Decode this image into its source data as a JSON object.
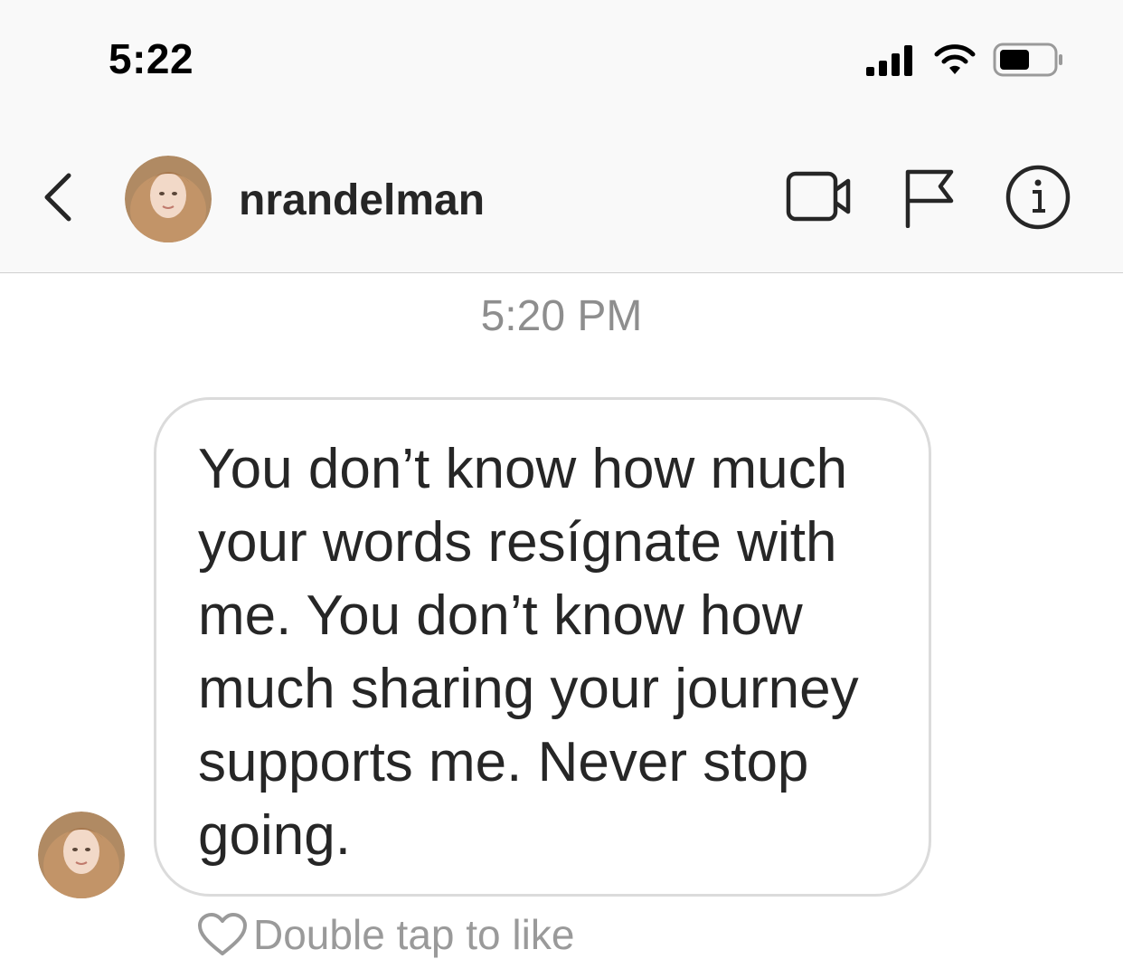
{
  "status_bar": {
    "time": "5:22",
    "icons": [
      "cellular-signal-icon",
      "wifi-icon",
      "battery-icon"
    ]
  },
  "header": {
    "back_icon": "chevron-left-icon",
    "username": "nrandelman",
    "actions": [
      "video-camera-icon",
      "flag-icon",
      "info-icon"
    ]
  },
  "thread": {
    "timestamp": "5:20 PM",
    "message": {
      "text": "You don’t know how much your words resígnate with me. You don’t know how much sharing your journey supports me. Never stop going.",
      "like_hint": "Double tap to like"
    }
  },
  "colors": {
    "header_bg": "#f9f9f9",
    "text_primary": "#262626",
    "text_secondary": "#8e8e8e",
    "bubble_border": "#dbdbdb"
  }
}
